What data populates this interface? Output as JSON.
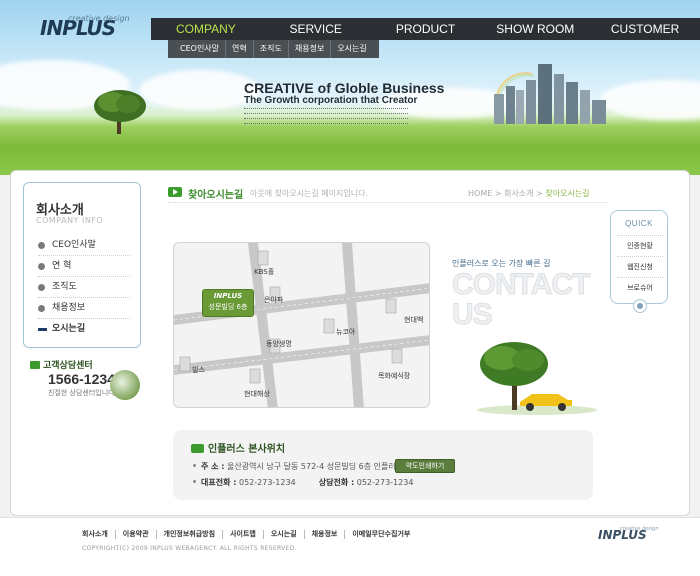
{
  "brand": {
    "logo": "INPLUS",
    "tagline": "creative design"
  },
  "nav": {
    "items": [
      {
        "label": "COMPANY",
        "active": true
      },
      {
        "label": "SERVICE",
        "active": false
      },
      {
        "label": "PRODUCT",
        "active": false
      },
      {
        "label": "SHOW ROOM",
        "active": false
      },
      {
        "label": "CUSTOMER",
        "active": false
      }
    ],
    "submenu": [
      "CEO인사말",
      "연혁",
      "조직도",
      "채용정보",
      "오시는길"
    ]
  },
  "hero": {
    "title": "CREATIVE of Globle Business",
    "subtitle": "The Growth corporation that Creator"
  },
  "sidebar": {
    "title": "회사소개",
    "subtitle": "COMPANY INFO",
    "items": [
      {
        "label": "CEO인사말",
        "active": false
      },
      {
        "label": "연 혁",
        "active": false
      },
      {
        "label": "조직도",
        "active": false
      },
      {
        "label": "채용정보",
        "active": false
      },
      {
        "label": "오시는길",
        "active": true
      }
    ]
  },
  "customer_center": {
    "label": "고객상담센터",
    "phone": "1566-1234",
    "note": "친절한 상담센터입니다"
  },
  "page": {
    "title": "찾아오시는길",
    "description": "아웃에 찾아오시는길 페이지입니다.",
    "breadcrumb": [
      "HOME",
      "회사소개",
      "찾아오시는길"
    ]
  },
  "quick_menu": {
    "title": "QUICK",
    "items": [
      "인증현황",
      "웹진신청",
      "브로슈어"
    ]
  },
  "map": {
    "sign_logo": "INPLUS",
    "sign_text": "성문빌딩 6층",
    "labels": [
      "KBS홀",
      "은아파",
      "동양생명",
      "뉴코아",
      "현대백",
      "목화예식장",
      "빌스",
      "현대해상"
    ]
  },
  "contact": {
    "tagline": "인플러스로 오는 가장 빠른 길",
    "big_text_1": "CONTACT",
    "big_text_2": "US"
  },
  "info": {
    "title": "인플러스 본사위치",
    "address_label": "주 소 :",
    "address": "울산광역시 남구 달동 572-4 성문빌딩 6층 인플러스",
    "map_button": "약도인쇄하기",
    "phone_label": "대표전화 :",
    "phone": "052-273-1234",
    "consult_label": "상담전화 :",
    "consult": "052-273-1234"
  },
  "footer": {
    "links": [
      "회사소개",
      "이용약관",
      "개인정보취급방침",
      "사이트맵",
      "오시는길",
      "채용정보",
      "이메일무단수집거부"
    ],
    "copyright": "COPYRIGHT(C) 2009 INPLUS WEBAGENCY. ALL RIGHTS RESERVED.",
    "logo": "INPLUS",
    "logo_tag": "creative design"
  },
  "colors": {
    "accent_green": "#3c9b2d",
    "nav_bg": "#2b2f33",
    "nav_active": "#b8e34a"
  }
}
